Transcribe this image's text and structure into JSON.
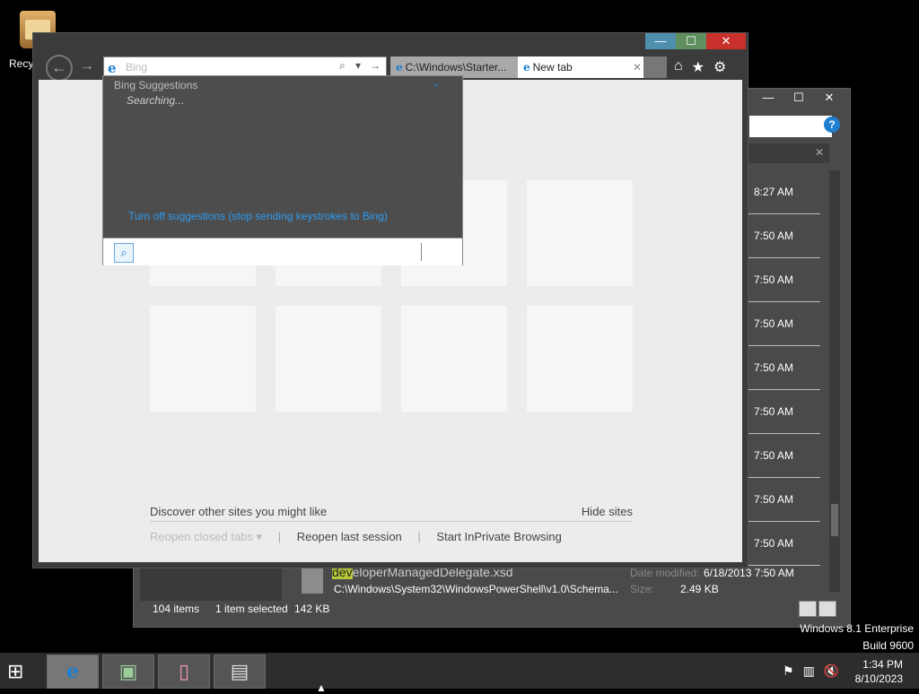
{
  "desktop": {
    "recycle_label": "Recy"
  },
  "explorer": {
    "window_buttons": [
      "—",
      "☐",
      "✕"
    ],
    "help_label": "?",
    "search_close": "✕",
    "times": [
      "8:27 AM",
      "7:50 AM",
      "7:50 AM",
      "7:50 AM",
      "7:50 AM",
      "7:50 AM",
      "7:50 AM",
      "7:50 AM",
      "7:50 AM"
    ],
    "file": {
      "name_highlight": "dev",
      "name_rest": "eloperManagedDelegate.xsd",
      "path": "C:\\Windows\\System32\\WindowsPowerShell\\v1.0\\Schema...",
      "date_label": "Date modified:",
      "date_value": "6/18/2013 7:50 AM",
      "size_label": "Size:",
      "size_value": "2.49 KB"
    },
    "status": {
      "items": "104 items",
      "selected": "1 item selected",
      "size": "142 KB"
    }
  },
  "ie": {
    "title_buttons": {
      "min": "—",
      "max": "☐",
      "close": "✕"
    },
    "nav": {
      "back": "←",
      "forward": "→"
    },
    "address": {
      "icon": "e",
      "value": "Bing",
      "search_glyph": "⌕",
      "dropdown": "▾",
      "go": "→"
    },
    "tabs": [
      {
        "label": "C:\\Windows\\Starter..."
      },
      {
        "label": "New tab",
        "close": "✕"
      }
    ],
    "toolbar": {
      "home": "⌂",
      "favorites": "★",
      "tools": "⚙"
    },
    "newtab": {
      "discover": "Discover other sites you might like",
      "hide_sites": "Hide sites",
      "reopen_closed": "Reopen closed tabs ▾",
      "reopen_last": "Reopen last session",
      "inprivate": "Start InPrivate Browsing"
    },
    "suggestions": {
      "header": "Bing Suggestions",
      "chevron": "⌄",
      "status": "Searching...",
      "turn_off": "Turn off suggestions (stop sending keystrokes to Bing)",
      "search_icon": "⌕"
    }
  },
  "system": {
    "os_name": "Windows 8.1 Enterprise",
    "build": "Build 9600",
    "time": "1:34 PM",
    "date": "8/10/2023"
  },
  "taskbar": {
    "start": "⊞",
    "apps": [
      {
        "name": "internet-explorer",
        "glyph": "e"
      },
      {
        "name": "app-2",
        "glyph": "▣"
      },
      {
        "name": "app-3",
        "glyph": "▯"
      },
      {
        "name": "app-4",
        "glyph": "▤"
      }
    ],
    "tray": {
      "flag": "⚑",
      "network": "▥",
      "volume": "🔇"
    }
  },
  "colors": {
    "accent": "#1d7fd1",
    "close_red": "#c9302c",
    "link_blue": "#2e9bf0"
  }
}
